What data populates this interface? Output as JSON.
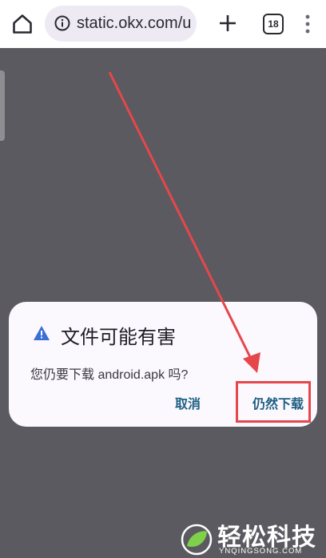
{
  "browser": {
    "url": "static.okx.com/u",
    "tab_count": "18",
    "icons": [
      "home-icon",
      "info-icon",
      "plus-icon",
      "tabs-icon",
      "overflow-menu-icon"
    ]
  },
  "dialog": {
    "title": "文件可能有害",
    "message": "您仍要下载 android.apk 吗?",
    "cancel_label": "取消",
    "confirm_label": "仍然下载",
    "warning_color": "#3b6fd6",
    "button_color": "#1d5f82"
  },
  "annotation": {
    "color": "#e5474b"
  },
  "watermark": {
    "brand": "轻松科技",
    "domain": "YNQINGSONG.COM"
  }
}
